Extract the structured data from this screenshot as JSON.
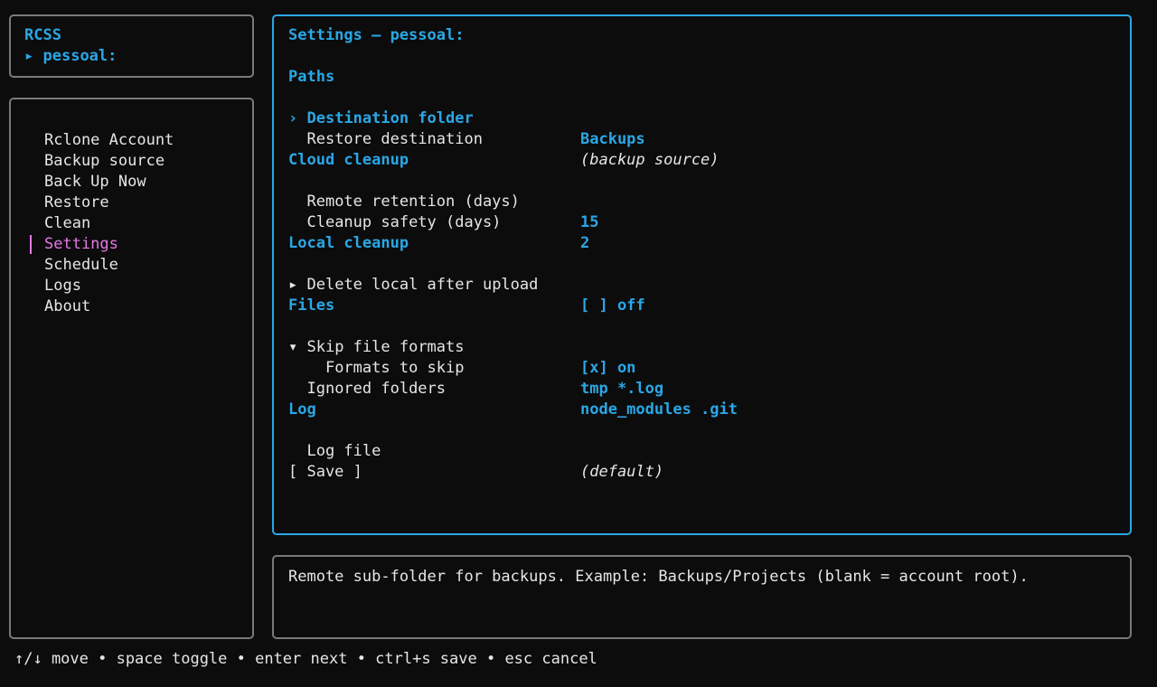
{
  "header": {
    "app_name": "RCSS",
    "account_marker": "▸",
    "account_name": "pessoal:"
  },
  "menu": {
    "items": [
      {
        "label": "Rclone Account",
        "selected": false
      },
      {
        "label": "Backup source",
        "selected": false
      },
      {
        "label": "Back Up Now",
        "selected": false
      },
      {
        "label": "Restore",
        "selected": false
      },
      {
        "label": "Clean",
        "selected": false
      },
      {
        "label": "Settings",
        "selected": true
      },
      {
        "label": "Schedule",
        "selected": false
      },
      {
        "label": "Logs",
        "selected": false
      },
      {
        "label": "About",
        "selected": false
      }
    ]
  },
  "settings": {
    "title": "Settings — pessoal:",
    "paths": {
      "heading": "Paths",
      "destination": {
        "marker": "›",
        "label": "Destination folder",
        "value": "Backups"
      },
      "restore": {
        "label": "Restore destination",
        "value": "(backup source)"
      }
    },
    "cloud": {
      "heading": "Cloud cleanup",
      "retention": {
        "label": "Remote retention (days)",
        "value": "15"
      },
      "safety": {
        "label": "Cleanup safety (days)",
        "value": "2"
      }
    },
    "local": {
      "heading": "Local cleanup",
      "delete": {
        "marker": "▸",
        "label": "Delete local after upload",
        "value": "[ ] off"
      }
    },
    "files": {
      "heading": "Files",
      "skip": {
        "marker": "▾",
        "label": "Skip file formats",
        "value": "[x] on"
      },
      "formats": {
        "label": "Formats to skip",
        "value": "tmp *.log"
      },
      "ignored": {
        "label": "Ignored folders",
        "value": "node_modules .git"
      }
    },
    "log": {
      "heading": "Log",
      "file": {
        "label": "Log file",
        "value": "(default)"
      }
    },
    "save_label": "[ Save ]"
  },
  "help": {
    "text": "Remote sub-folder for backups. Example: Backups/Projects (blank = account root)."
  },
  "footer": {
    "hints": "↑/↓ move • space toggle • enter next • ctrl+s save • esc cancel"
  },
  "colors": {
    "accent": "#2aa7e6",
    "selected": "#e678e6",
    "border": "#7a7a7a",
    "background": "#0c0c0c",
    "text": "#e6e6e6"
  }
}
